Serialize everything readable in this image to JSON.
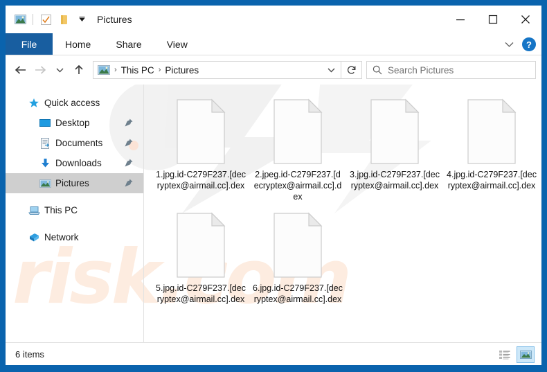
{
  "window": {
    "title": "Pictures",
    "quick_access_toolbar": [
      {
        "name": "window-icon",
        "glyph": "picture"
      },
      {
        "name": "properties-icon",
        "glyph": "checkbox"
      },
      {
        "name": "new-folder-icon",
        "glyph": "folder"
      },
      {
        "name": "customize-qat-icon",
        "glyph": "chevron-down"
      }
    ],
    "caption_buttons": [
      {
        "name": "minimize",
        "label": "—"
      },
      {
        "name": "maximize",
        "label": "☐"
      },
      {
        "name": "close",
        "label": "✕"
      }
    ]
  },
  "ribbon": {
    "file_tab": "File",
    "tabs": [
      "Home",
      "Share",
      "View"
    ],
    "expand_label": "⌄",
    "help_label": "?"
  },
  "address_bar": {
    "back_tooltip": "Back",
    "forward_tooltip": "Forward",
    "recent_tooltip": "Recent locations",
    "up_tooltip": "Up",
    "breadcrumb": [
      "This PC",
      "Pictures"
    ],
    "separator": "›",
    "dropdown_label": "⌄",
    "refresh_label": "↻"
  },
  "search": {
    "placeholder": "Search Pictures",
    "value": ""
  },
  "sidebar": {
    "items": [
      {
        "label": "Quick access",
        "icon": "star-icon",
        "level": 0,
        "pinned": false,
        "selected": false
      },
      {
        "label": "Desktop",
        "icon": "desktop-icon",
        "level": 1,
        "pinned": true,
        "selected": false
      },
      {
        "label": "Documents",
        "icon": "documents-icon",
        "level": 1,
        "pinned": true,
        "selected": false
      },
      {
        "label": "Downloads",
        "icon": "downloads-icon",
        "level": 1,
        "pinned": true,
        "selected": false
      },
      {
        "label": "Pictures",
        "icon": "pictures-icon",
        "level": 1,
        "pinned": true,
        "selected": true
      },
      {
        "label": "This PC",
        "icon": "this-pc-icon",
        "level": 0,
        "pinned": false,
        "selected": false
      },
      {
        "label": "Network",
        "icon": "network-icon",
        "level": 0,
        "pinned": false,
        "selected": false
      }
    ]
  },
  "files": [
    {
      "name": "1.jpg.id-C279F237.[decryptex@airmail.cc].dex",
      "icon": "generic-file-icon"
    },
    {
      "name": "2.jpeg.id-C279F237.[decryptex@airmail.cc].dex",
      "icon": "generic-file-icon"
    },
    {
      "name": "3.jpg.id-C279F237.[decryptex@airmail.cc].dex",
      "icon": "generic-file-icon"
    },
    {
      "name": "4.jpg.id-C279F237.[decryptex@airmail.cc].dex",
      "icon": "generic-file-icon"
    },
    {
      "name": "5.jpg.id-C279F237.[decryptex@airmail.cc].dex",
      "icon": "generic-file-icon"
    },
    {
      "name": "6.jpg.id-C279F237.[decryptex@airmail.cc].dex",
      "icon": "generic-file-icon"
    }
  ],
  "status_bar": {
    "item_count": "6 items",
    "views": [
      {
        "name": "details-view-button",
        "active": false
      },
      {
        "name": "large-icons-view-button",
        "active": true
      }
    ]
  },
  "watermark": {
    "text": "risk.com"
  },
  "colors": {
    "window_frame": "#0a63ad",
    "file_tab": "#185ea0",
    "selection": "#cfcfcf",
    "help_blue": "#1675c6",
    "watermark": "#fdece0",
    "view_active": "#cde8f9"
  }
}
